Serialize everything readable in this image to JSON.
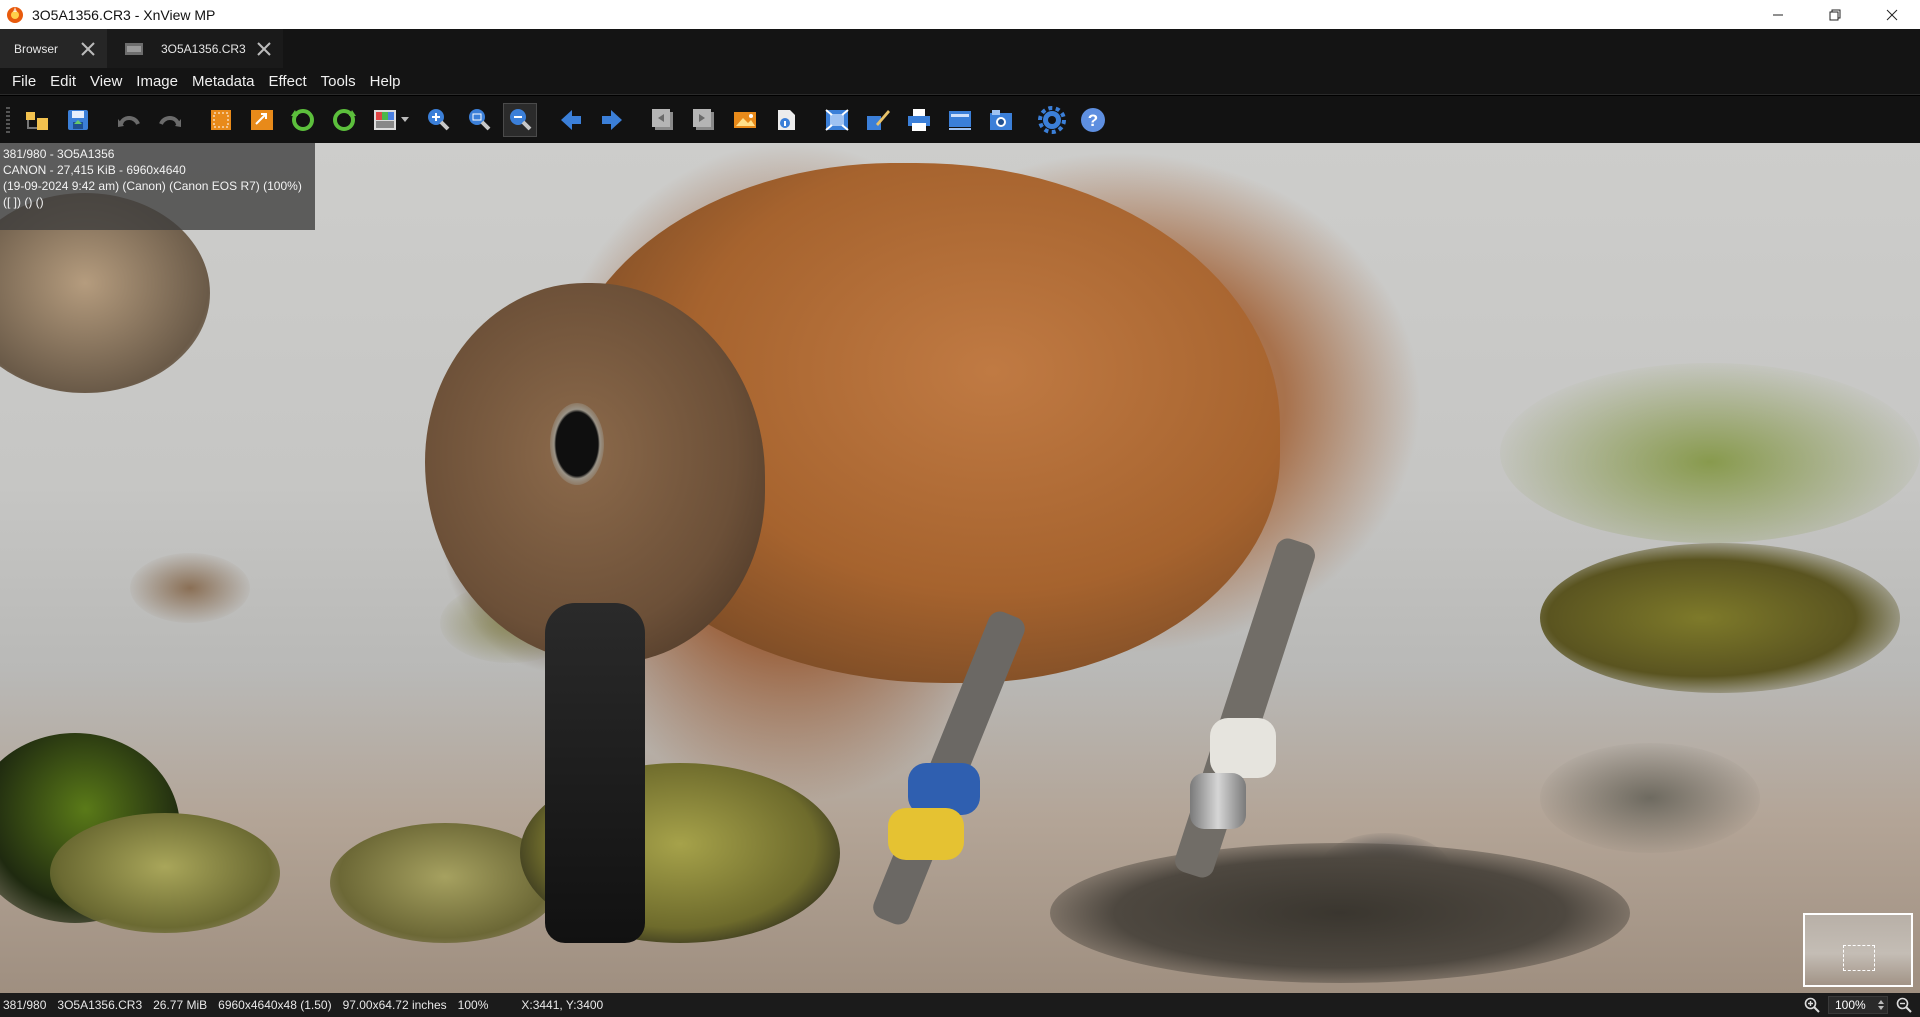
{
  "window": {
    "title": "3O5A1356.CR3 - XnView MP"
  },
  "tabs": [
    {
      "label": "Browser"
    },
    {
      "label": "3O5A1356.CR3"
    }
  ],
  "menu": [
    "File",
    "Edit",
    "View",
    "Image",
    "Metadata",
    "Effect",
    "Tools",
    "Help"
  ],
  "toolbar": {
    "icons": [
      "open-folder-icon",
      "save-icon",
      "undo-icon",
      "redo-icon",
      "crop-icon",
      "resize-icon",
      "rotate-left-icon",
      "rotate-right-icon",
      "color-adjust-icon",
      "zoom-in-icon",
      "zoom-fit-icon",
      "zoom-out-icon",
      "previous-icon",
      "next-icon",
      "first-page-icon",
      "last-page-icon",
      "set-wallpaper-icon",
      "properties-icon",
      "fullscreen-icon",
      "edit-icon",
      "print-icon",
      "scan-icon",
      "screen-capture-icon",
      "settings-icon",
      "help-icon"
    ]
  },
  "overlay": {
    "line1": "381/980 - 3O5A1356",
    "line2": "CANON - 27,415 KiB - 6960x4640",
    "line3": "(19-09-2024 9:42 am) (Canon) (Canon EOS R7) (100%)",
    "line4": "([ ]) () ()"
  },
  "status": {
    "position": "381/980",
    "filename": "3O5A1356.CR3",
    "filesize": "26.77 MiB",
    "dimensions": "6960x4640x48 (1.50)",
    "print_size": "97.00x64.72 inches",
    "zoom_pct": "100%",
    "coords": "X:3441, Y:3400",
    "zoom_value": "100%"
  },
  "colors": {
    "app_bg": "#141414",
    "accent_blue": "#3b7fd8",
    "ring_blue": "#2f5fb0",
    "ring_yellow": "#e5c232"
  }
}
